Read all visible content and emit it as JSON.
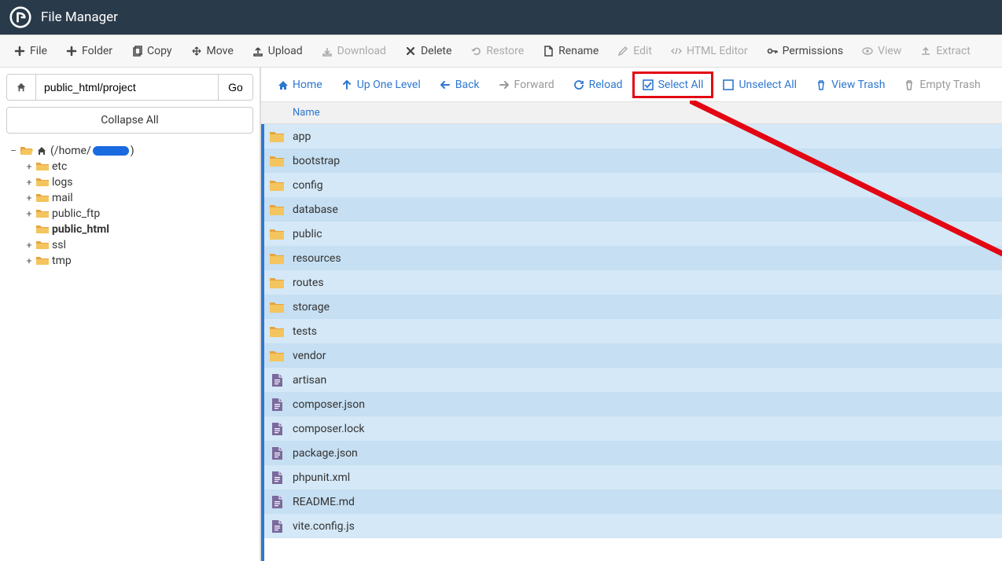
{
  "app": {
    "title": "File Manager"
  },
  "toolbar": [
    {
      "id": "file",
      "label": "File",
      "icon": "plus",
      "enabled": true
    },
    {
      "id": "folder",
      "label": "Folder",
      "icon": "plus",
      "enabled": true
    },
    {
      "id": "copy",
      "label": "Copy",
      "icon": "copy",
      "enabled": true
    },
    {
      "id": "move",
      "label": "Move",
      "icon": "move",
      "enabled": true
    },
    {
      "id": "upload",
      "label": "Upload",
      "icon": "upload",
      "enabled": true
    },
    {
      "id": "download",
      "label": "Download",
      "icon": "download",
      "enabled": false
    },
    {
      "id": "delete",
      "label": "Delete",
      "icon": "x",
      "enabled": true
    },
    {
      "id": "restore",
      "label": "Restore",
      "icon": "undo",
      "enabled": false
    },
    {
      "id": "rename",
      "label": "Rename",
      "icon": "file",
      "enabled": true
    },
    {
      "id": "edit",
      "label": "Edit",
      "icon": "pencil",
      "enabled": false
    },
    {
      "id": "htmleditor",
      "label": "HTML Editor",
      "icon": "code",
      "enabled": false
    },
    {
      "id": "permissions",
      "label": "Permissions",
      "icon": "key",
      "enabled": true
    },
    {
      "id": "view",
      "label": "View",
      "icon": "eye",
      "enabled": false
    },
    {
      "id": "extract",
      "label": "Extract",
      "icon": "extract",
      "enabled": false
    }
  ],
  "path": {
    "value": "public_html/project",
    "go": "Go"
  },
  "collapse_all": "Collapse All",
  "tree": {
    "root": {
      "expanded": true,
      "label_prefix": " (/home/",
      "label_suffix": ")"
    },
    "children": [
      {
        "id": "etc",
        "label": "etc",
        "expandable": true
      },
      {
        "id": "logs",
        "label": "logs",
        "expandable": true
      },
      {
        "id": "mail",
        "label": "mail",
        "expandable": true
      },
      {
        "id": "public_ftp",
        "label": "public_ftp",
        "expandable": true
      },
      {
        "id": "public_html",
        "label": "public_html",
        "expandable": false,
        "bold": true
      },
      {
        "id": "ssl",
        "label": "ssl",
        "expandable": true
      },
      {
        "id": "tmp",
        "label": "tmp",
        "expandable": true
      }
    ]
  },
  "actionbar": [
    {
      "id": "home",
      "label": "Home",
      "icon": "home",
      "color": "blue"
    },
    {
      "id": "upone",
      "label": "Up One Level",
      "icon": "up",
      "color": "blue"
    },
    {
      "id": "back",
      "label": "Back",
      "icon": "left",
      "color": "blue"
    },
    {
      "id": "forward",
      "label": "Forward",
      "icon": "right",
      "color": "gray"
    },
    {
      "id": "reload",
      "label": "Reload",
      "icon": "reload",
      "color": "blue"
    },
    {
      "id": "selectall",
      "label": "Select All",
      "icon": "check",
      "color": "blue",
      "highlight": true
    },
    {
      "id": "unselectall",
      "label": "Unselect All",
      "icon": "square",
      "color": "blue"
    },
    {
      "id": "viewtrash",
      "label": "View Trash",
      "icon": "trash",
      "color": "blue"
    },
    {
      "id": "emptytrash",
      "label": "Empty Trash",
      "icon": "trash",
      "color": "gray"
    }
  ],
  "column_header": "Name",
  "files": [
    {
      "name": "app",
      "type": "folder"
    },
    {
      "name": "bootstrap",
      "type": "folder"
    },
    {
      "name": "config",
      "type": "folder"
    },
    {
      "name": "database",
      "type": "folder"
    },
    {
      "name": "public",
      "type": "folder"
    },
    {
      "name": "resources",
      "type": "folder"
    },
    {
      "name": "routes",
      "type": "folder"
    },
    {
      "name": "storage",
      "type": "folder"
    },
    {
      "name": "tests",
      "type": "folder"
    },
    {
      "name": "vendor",
      "type": "folder"
    },
    {
      "name": "artisan",
      "type": "file"
    },
    {
      "name": "composer.json",
      "type": "file"
    },
    {
      "name": "composer.lock",
      "type": "file"
    },
    {
      "name": "package.json",
      "type": "file"
    },
    {
      "name": "phpunit.xml",
      "type": "file"
    },
    {
      "name": "README.md",
      "type": "file"
    },
    {
      "name": "vite.config.js",
      "type": "file"
    }
  ]
}
